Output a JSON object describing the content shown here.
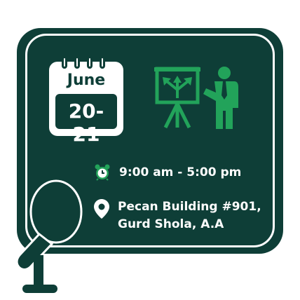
{
  "calendar": {
    "month": "June",
    "dates": "20-21"
  },
  "event": {
    "time": "9:00 am - 5:00 pm",
    "location_line1": "Pecan Building #901,",
    "location_line2": "Gurd Shola, A.A"
  },
  "colors": {
    "board": "#0e3e37",
    "accent": "#22a35a",
    "text": "#ffffff"
  },
  "icons": [
    "calendar-icon",
    "presenter-icon",
    "alarm-clock-icon",
    "location-pin-icon",
    "microphone-icon"
  ]
}
